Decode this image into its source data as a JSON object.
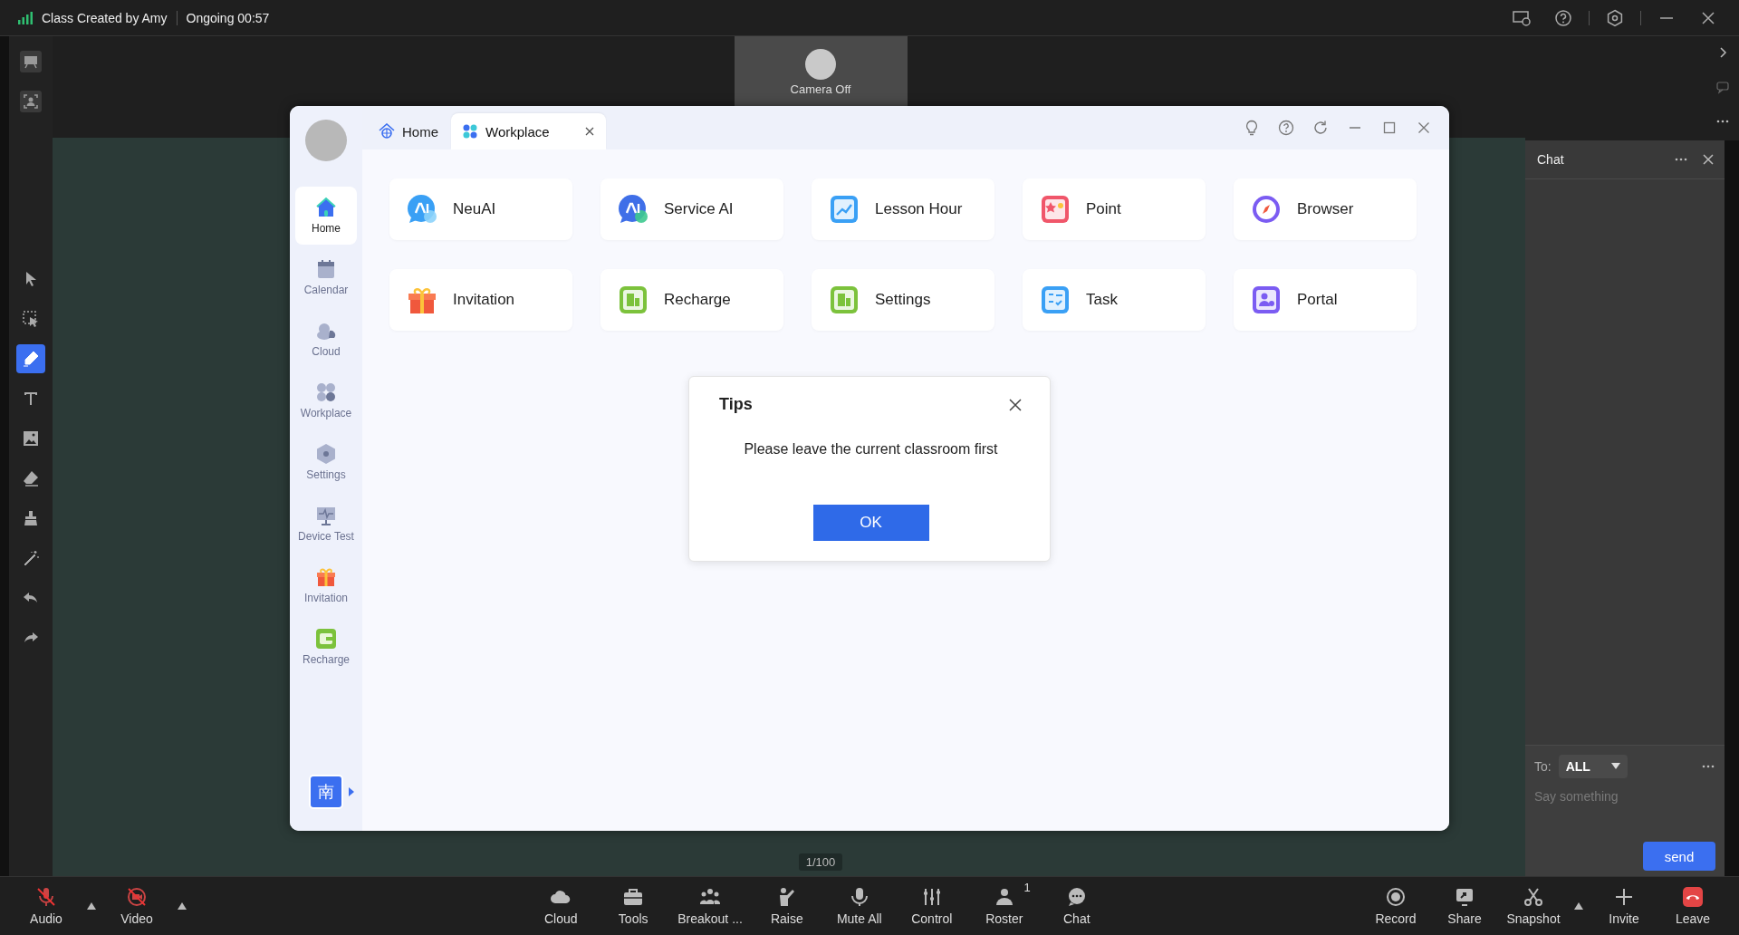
{
  "top_bar": {
    "title": "Class Created by Amy",
    "status": "Ongoing 00:57"
  },
  "camera_tile": {
    "label": "Camera Off"
  },
  "drawing_tools": [
    {
      "selected": false
    },
    {
      "selected": false
    },
    {
      "selected": true
    },
    {
      "selected": false
    },
    {
      "selected": false
    },
    {
      "selected": false
    },
    {
      "selected": false
    },
    {
      "selected": false
    },
    {
      "selected": false
    },
    {
      "selected": false
    }
  ],
  "window": {
    "tabs": [
      {
        "label": "Home",
        "selected": false,
        "closable": false
      },
      {
        "label": "Workplace",
        "selected": true,
        "closable": true
      }
    ],
    "sidebar": {
      "items": [
        {
          "label": "Home",
          "selected": true
        },
        {
          "label": "Calendar",
          "selected": false
        },
        {
          "label": "Cloud",
          "selected": false
        },
        {
          "label": "Workplace",
          "selected": false
        },
        {
          "label": "Settings",
          "selected": false
        },
        {
          "label": "Device Test",
          "selected": false
        },
        {
          "label": "Invitation",
          "selected": false
        },
        {
          "label": "Recharge",
          "selected": false
        }
      ],
      "language_button": "南"
    },
    "apps": [
      {
        "label": "NeuAI"
      },
      {
        "label": "Service AI"
      },
      {
        "label": "Lesson Hour"
      },
      {
        "label": "Point"
      },
      {
        "label": "Browser"
      },
      {
        "label": "Invitation"
      },
      {
        "label": "Recharge"
      },
      {
        "label": "Settings"
      },
      {
        "label": "Task"
      },
      {
        "label": "Portal"
      }
    ],
    "dialog": {
      "title": "Tips",
      "message": "Please leave the current classroom first",
      "button": "OK"
    }
  },
  "page_counter": "1/100",
  "chat": {
    "title": "Chat",
    "to_label": "To:",
    "recipient": "ALL",
    "placeholder": "Say something",
    "send": "send"
  },
  "bottom_bar": {
    "left": [
      {
        "label": "Audio",
        "muted": true
      },
      {
        "label": "Video",
        "muted": true
      }
    ],
    "center": [
      {
        "label": "Cloud"
      },
      {
        "label": "Tools"
      },
      {
        "label": "Breakout ..."
      },
      {
        "label": "Raise"
      },
      {
        "label": "Mute All"
      },
      {
        "label": "Control"
      },
      {
        "label": "Roster",
        "badge": "1"
      },
      {
        "label": "Chat"
      }
    ],
    "right": [
      {
        "label": "Record"
      },
      {
        "label": "Share"
      },
      {
        "label": "Snapshot"
      },
      {
        "label": "Invite"
      },
      {
        "label": "Leave"
      }
    ]
  }
}
